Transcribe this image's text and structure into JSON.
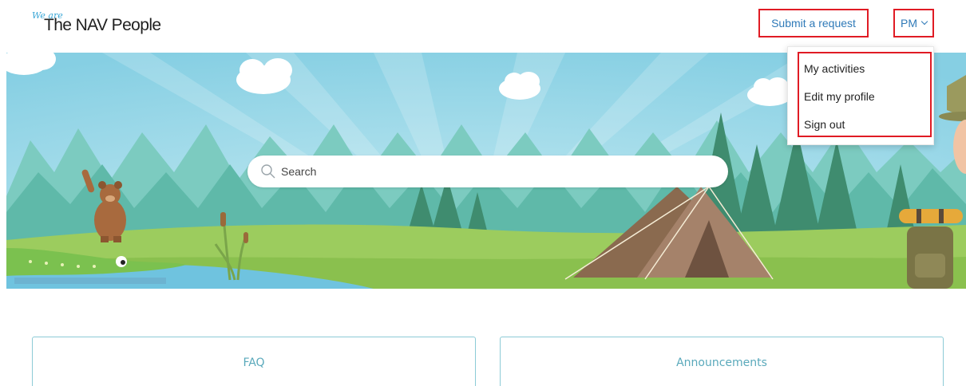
{
  "brand": {
    "prefix": "We are",
    "name": "The NAV People"
  },
  "header": {
    "submit_label": "Submit a request",
    "user_initials": "PM"
  },
  "search": {
    "placeholder": "Search"
  },
  "user_menu": {
    "items": [
      "My activities",
      "Edit my profile",
      "Sign out"
    ]
  },
  "cards": [
    {
      "title": "FAQ"
    },
    {
      "title": "Announcements"
    }
  ],
  "colors": {
    "accent_blue": "#2f7ab8",
    "highlight_red": "#e01b24",
    "card_border": "#8ccbd6",
    "card_title": "#5aa9bb"
  }
}
